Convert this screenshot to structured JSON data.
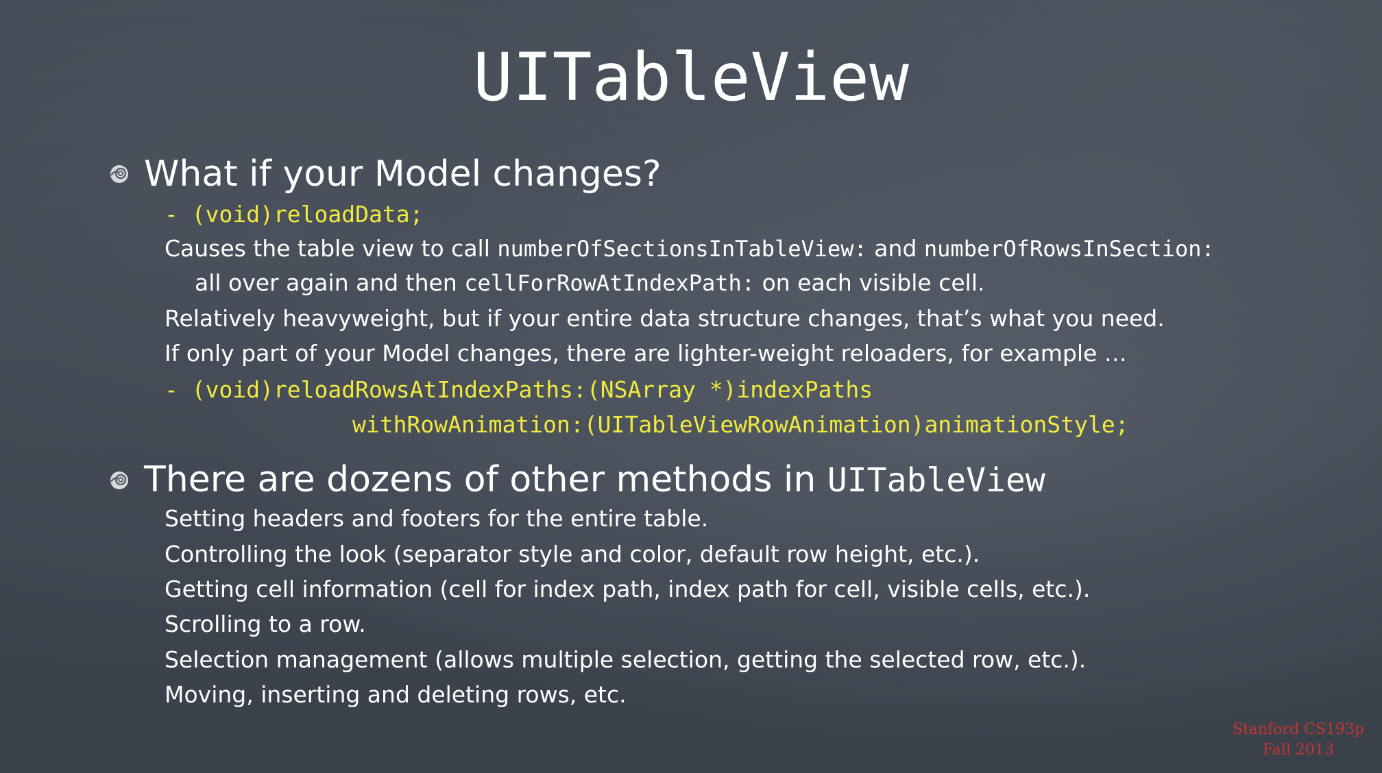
{
  "slide": {
    "title": "UITableView",
    "section1": {
      "heading": "What if your Model changes?",
      "code1": "- (void)reloadData;",
      "line_causes_a": "Causes the table view to call ",
      "line_causes_b": "numberOfSectionsInTableView:",
      "line_causes_c": " and ",
      "line_causes_d": "numberOfRowsInSection:",
      "line_allover_a": "all over again and then ",
      "line_allover_b": "cellForRowAtIndexPath:",
      "line_allover_c": " on each visible cell.",
      "line_relatively": "Relatively heavyweight, but if your entire data structure changes, that’s what you need.",
      "line_ifonly": "If only part of your Model changes, there are lighter-weight reloaders, for example …",
      "code2": "- (void)reloadRowsAtIndexPaths:(NSArray *)indexPaths",
      "code3": "withRowAnimation:(UITableViewRowAnimation)animationStyle;"
    },
    "section2": {
      "heading_a": "There are dozens of other methods in ",
      "heading_b": "UITableView",
      "items": [
        "Setting headers and footers for the entire table.",
        "Controlling the look (separator style and color, default row height, etc.).",
        "Getting cell information (cell for index path, index path for cell, visible cells, etc.).",
        "Scrolling to a row.",
        "Selection management (allows multiple selection, getting the selected row, etc.).",
        "Moving, inserting and deleting rows, etc."
      ]
    },
    "credit": {
      "line1": "Stanford CS193p",
      "line2": "Fall 2013"
    }
  }
}
